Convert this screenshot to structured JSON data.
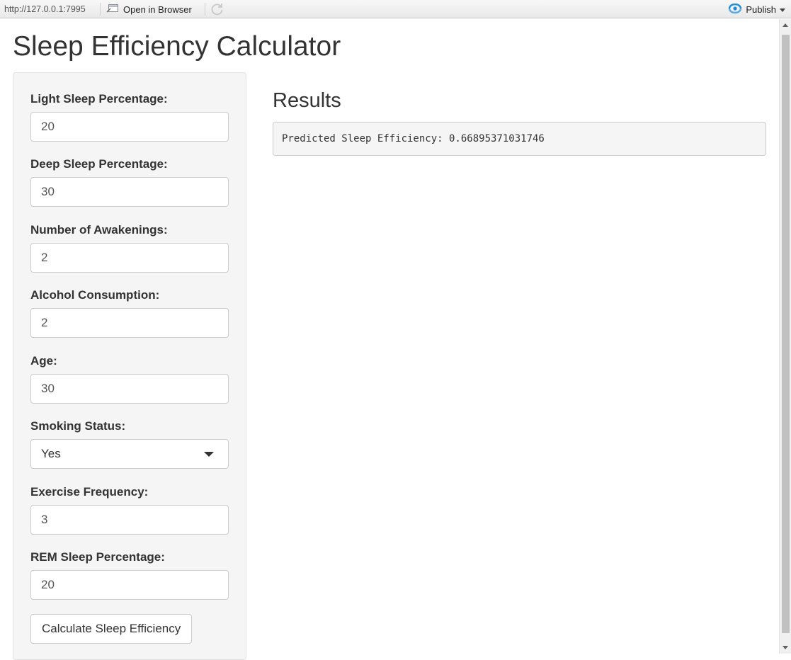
{
  "toolbar": {
    "url": "http://127.0.0.1:7995",
    "open_in_browser_label": "Open in Browser",
    "publish_label": "Publish",
    "publish_color": "#1a8cd8"
  },
  "page": {
    "title": "Sleep Efficiency Calculator"
  },
  "sidebar": {
    "fields": [
      {
        "label": "Light Sleep Percentage:",
        "value": "20"
      },
      {
        "label": "Deep Sleep Percentage:",
        "value": "30"
      },
      {
        "label": "Number of Awakenings:",
        "value": "2"
      },
      {
        "label": "Alcohol Consumption:",
        "value": "2"
      },
      {
        "label": "Age:",
        "value": "30"
      },
      {
        "label": "Smoking Status:",
        "value": "Yes"
      },
      {
        "label": "Exercise Frequency:",
        "value": "3"
      },
      {
        "label": "REM Sleep Percentage:",
        "value": "20"
      }
    ],
    "button_label": "Calculate Sleep Efficiency"
  },
  "results": {
    "title": "Results",
    "output": "Predicted Sleep Efficiency: 0.66895371031746"
  },
  "icons": {
    "open_in_browser": "browser-window-icon",
    "refresh": "refresh-icon",
    "publish": "publish-icon",
    "select_caret": "caret-down-icon"
  }
}
